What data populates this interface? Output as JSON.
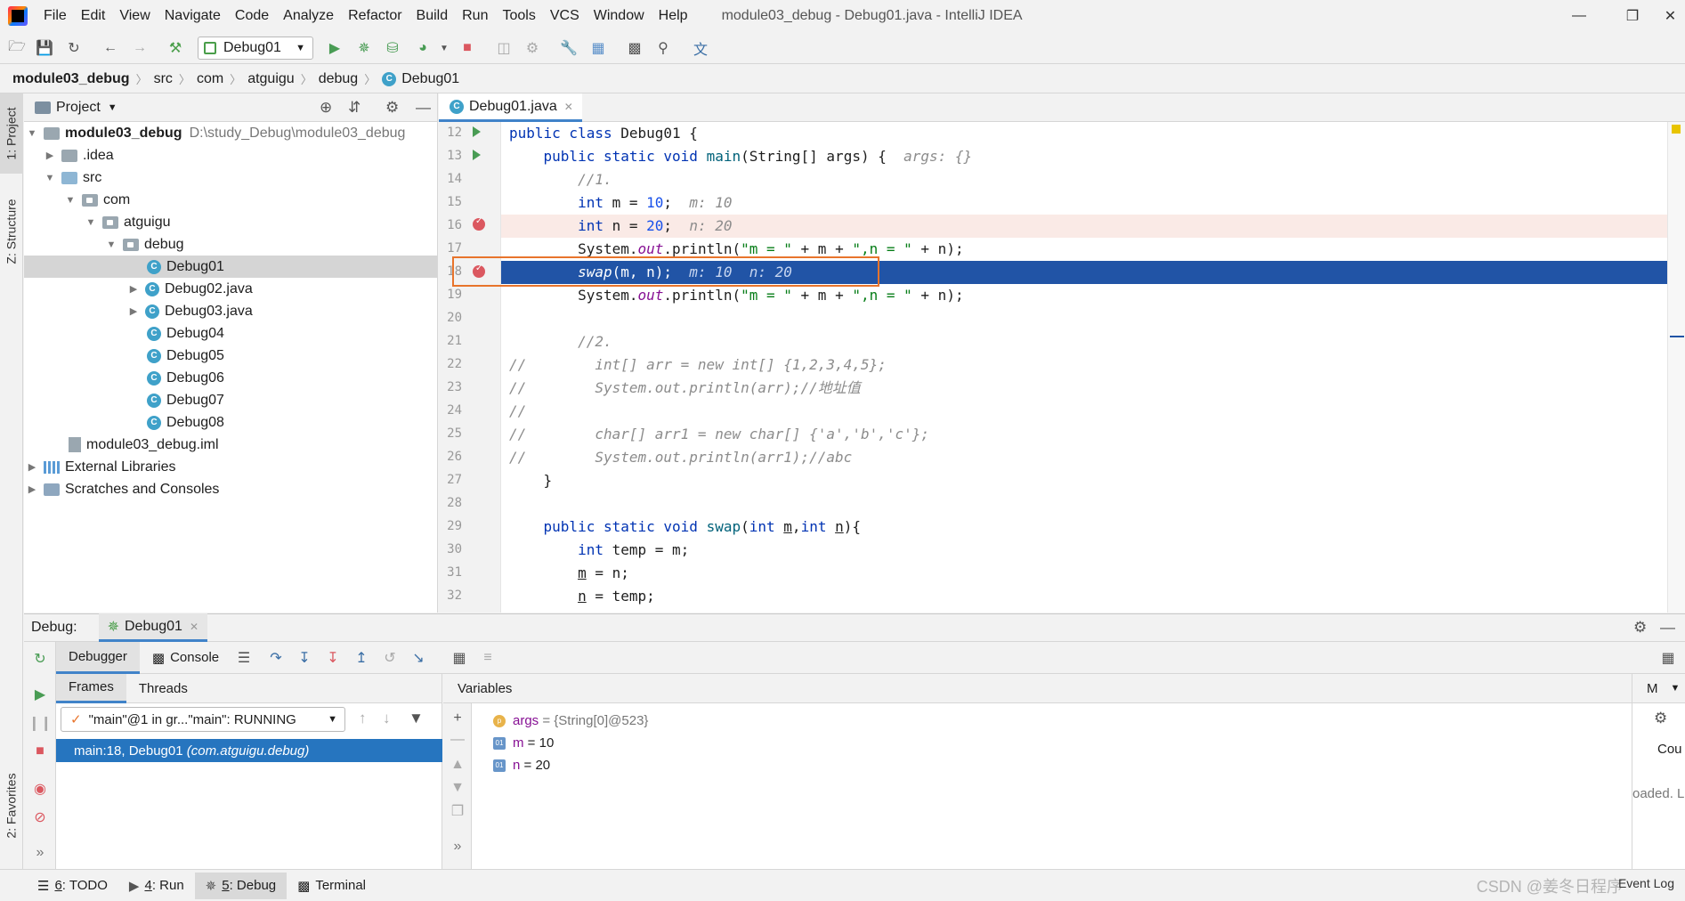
{
  "titlebar": {
    "menu": [
      "File",
      "Edit",
      "View",
      "Navigate",
      "Code",
      "Analyze",
      "Refactor",
      "Build",
      "Run",
      "Tools",
      "VCS",
      "Window",
      "Help"
    ],
    "window_title": "module03_debug - Debug01.java - IntelliJ IDEA"
  },
  "toolbar": {
    "run_config": "Debug01"
  },
  "breadcrumb": [
    "module03_debug",
    "src",
    "com",
    "atguigu",
    "debug",
    "Debug01"
  ],
  "left_stripe": {
    "project": "1: Project",
    "structure": "Z: Structure",
    "favorites": "2: Favorites"
  },
  "project": {
    "title": "Project",
    "tree": [
      {
        "label": "module03_debug",
        "extra": "D:\\study_Debug\\module03_debug"
      },
      {
        "label": ".idea"
      },
      {
        "label": "src"
      },
      {
        "label": "com"
      },
      {
        "label": "atguigu"
      },
      {
        "label": "debug"
      },
      {
        "label": "Debug01"
      },
      {
        "label": "Debug02.java"
      },
      {
        "label": "Debug03.java"
      },
      {
        "label": "Debug04"
      },
      {
        "label": "Debug05"
      },
      {
        "label": "Debug06"
      },
      {
        "label": "Debug07"
      },
      {
        "label": "Debug08"
      },
      {
        "label": "module03_debug.iml"
      },
      {
        "label": "External Libraries"
      },
      {
        "label": "Scratches and Consoles"
      }
    ]
  },
  "editor": {
    "tab": "Debug01.java",
    "line_numbers": [
      "12",
      "13",
      "14",
      "15",
      "16",
      "17",
      "18",
      "19",
      "20",
      "21",
      "22",
      "23",
      "24",
      "25",
      "26",
      "27",
      "28",
      "29",
      "30",
      "31",
      "32"
    ],
    "hints": {
      "args": "args: {}",
      "m": "m: 10",
      "n": "n: 20",
      "swap": "m: 10  n: 20"
    },
    "comments": {
      "c1": "//1.",
      "c2": "//2.",
      "c22": "//        int[] arr = new int[] {1,2,3,4,5};",
      "c23": "//        System.out.println(arr);//地址值",
      "c24": "//",
      "c25": "//        char[] arr1 = new char[] {'a','b','c'};",
      "c26": "//        System.out.println(arr1);//abc"
    }
  },
  "debug": {
    "label": "Debug:",
    "session_tab": "Debug01",
    "tabs": {
      "debugger": "Debugger",
      "console": "Console"
    },
    "frames_tab": "Frames",
    "threads_tab": "Threads",
    "thread_select": "\"main\"@1 in gr...\"main\": RUNNING",
    "frame": "main:18, Debug01",
    "frame_pkg": "(com.atguigu.debug)",
    "variables_title": "Variables",
    "variables": [
      {
        "name": "args",
        "value": "= {String[0]@523}",
        "icon": "p"
      },
      {
        "name": "m",
        "value": "= 10",
        "icon": "01"
      },
      {
        "name": "n",
        "value": "= 20",
        "icon": "01"
      }
    ],
    "watches_partial": {
      "head": "M",
      "text1": "Cou",
      "text2": "oaded. L"
    }
  },
  "bottom_bar": {
    "todo_num": "6",
    "todo": ": TODO",
    "run_num": "4",
    "run": ": Run",
    "debug_num": "5",
    "debug": ": Debug",
    "terminal": "Terminal",
    "event_log": "Event Log",
    "watermark": "CSDN @姜冬日程序"
  },
  "colors": {
    "exec_line": "#2154a6",
    "breakpoint": "#db5860",
    "highlight_frame": "#e8742c",
    "selected_frame": "#2675bf"
  }
}
